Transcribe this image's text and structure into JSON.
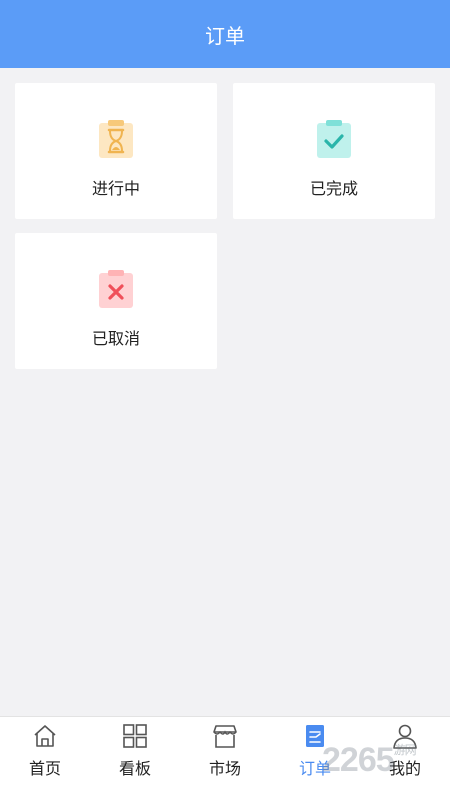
{
  "header": {
    "title": "订单"
  },
  "cards": [
    {
      "label": "进行中",
      "icon": "hourglass-clipboard-icon",
      "color": "#f7c97a"
    },
    {
      "label": "已完成",
      "icon": "check-clipboard-icon",
      "color": "#7fe0d8"
    },
    {
      "label": "已取消",
      "icon": "cancel-clipboard-icon",
      "color": "#ffb3b5"
    }
  ],
  "tabbar": {
    "items": [
      {
        "label": "首页",
        "icon": "home-icon"
      },
      {
        "label": "看板",
        "icon": "grid-icon"
      },
      {
        "label": "市场",
        "icon": "store-icon"
      },
      {
        "label": "订单",
        "icon": "order-icon",
        "active": true
      },
      {
        "label": "我的",
        "icon": "user-icon"
      }
    ]
  },
  "colors": {
    "accent": "#5b9cf7",
    "tab_active": "#4a8bf0"
  }
}
